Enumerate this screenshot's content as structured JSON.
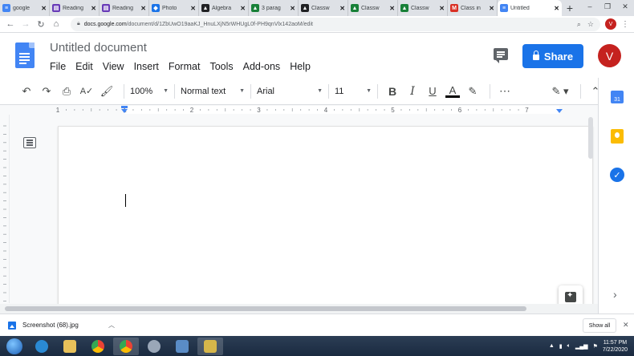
{
  "browser": {
    "tabs": [
      {
        "title": "google",
        "fav_color": "#4285f4",
        "fav_glyph": "≡"
      },
      {
        "title": "Reading",
        "fav_color": "#673ab7",
        "fav_glyph": "▤"
      },
      {
        "title": "Reading",
        "fav_color": "#673ab7",
        "fav_glyph": "▤"
      },
      {
        "title": "Photo",
        "fav_color": "#1a73e8",
        "fav_glyph": "◆"
      },
      {
        "title": "Algebra",
        "fav_color": "#202124",
        "fav_glyph": "▲"
      },
      {
        "title": "3 parag",
        "fav_color": "#188038",
        "fav_glyph": "▲"
      },
      {
        "title": "Classw",
        "fav_color": "#202124",
        "fav_glyph": "▲"
      },
      {
        "title": "Classw",
        "fav_color": "#188038",
        "fav_glyph": "▲"
      },
      {
        "title": "Classw",
        "fav_color": "#188038",
        "fav_glyph": "▲"
      },
      {
        "title": "Class in",
        "fav_color": "#d93025",
        "fav_glyph": "M"
      },
      {
        "title": "Untitled",
        "fav_color": "#4285f4",
        "fav_glyph": "≡",
        "active": true
      }
    ],
    "new_tab": "+",
    "window_controls": [
      "–",
      "❐",
      "✕"
    ],
    "address": {
      "host": "docs.google.com",
      "path": "/document/d/1ZbUwO19aaKJ_HnuLXjN5rWHUgL0f-PH9qnVlx142aoM/edit"
    },
    "profile_initial": "V"
  },
  "docs": {
    "title": "Untitled document",
    "menu": [
      "File",
      "Edit",
      "View",
      "Insert",
      "Format",
      "Tools",
      "Add-ons",
      "Help"
    ],
    "share_label": "Share",
    "avatar_initial": "V",
    "toolbar": {
      "zoom": "100%",
      "style": "Normal text",
      "font": "Arial",
      "size": "11",
      "bold": "B",
      "italic": "I",
      "underline": "U",
      "text_color": "A",
      "more": "⋯"
    },
    "ruler_numbers": [
      "1",
      "1",
      "2",
      "3",
      "4",
      "5",
      "6",
      "7"
    ],
    "side_panel": {
      "calendar_day": "31",
      "expand": "›"
    }
  },
  "downloads": {
    "file_name": "Screenshot (68).jpg",
    "show_all": "Show all"
  },
  "taskbar": {
    "time": "11:57 PM",
    "date": "7/22/2020"
  },
  "colors": {
    "accent": "#1a73e8",
    "avatar": "#c5221f",
    "docs_blue": "#4285f4"
  }
}
